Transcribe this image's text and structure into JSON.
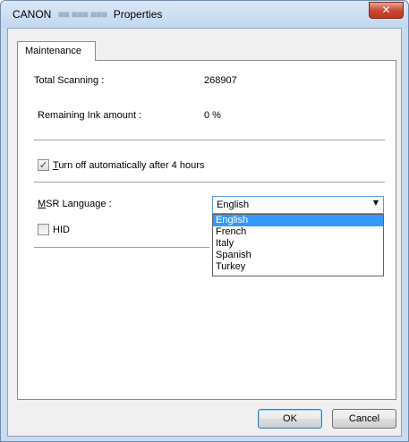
{
  "window": {
    "title_prefix": "CANON",
    "title_model": "■■ ■■■ ■■■",
    "title_suffix": "Properties",
    "close_glyph": "✕"
  },
  "tabs": [
    {
      "label": "Maintenance"
    }
  ],
  "maintenance": {
    "total_scanning_label": "Total Scanning :",
    "total_scanning_value": "268907",
    "remaining_ink_label": "Remaining Ink amount :",
    "remaining_ink_value": "0 %",
    "auto_off": {
      "accel": "T",
      "rest": "urn off automatically after 4 hours",
      "checked": true
    },
    "msr_language": {
      "accel": "M",
      "rest": "SR Language :",
      "selected": "English",
      "options": [
        "English",
        "French",
        "Italy",
        "Spanish",
        "Turkey"
      ]
    },
    "hid": {
      "label": "HID",
      "checked": false
    }
  },
  "buttons": {
    "ok": "OK",
    "cancel": "Cancel"
  },
  "icons": {
    "checkmark": "✓",
    "dropdown_arrow": "▼"
  },
  "colors": {
    "selection": "#3399ff",
    "close_button": "#c74a35",
    "titlebar": "#c3d7ee"
  }
}
